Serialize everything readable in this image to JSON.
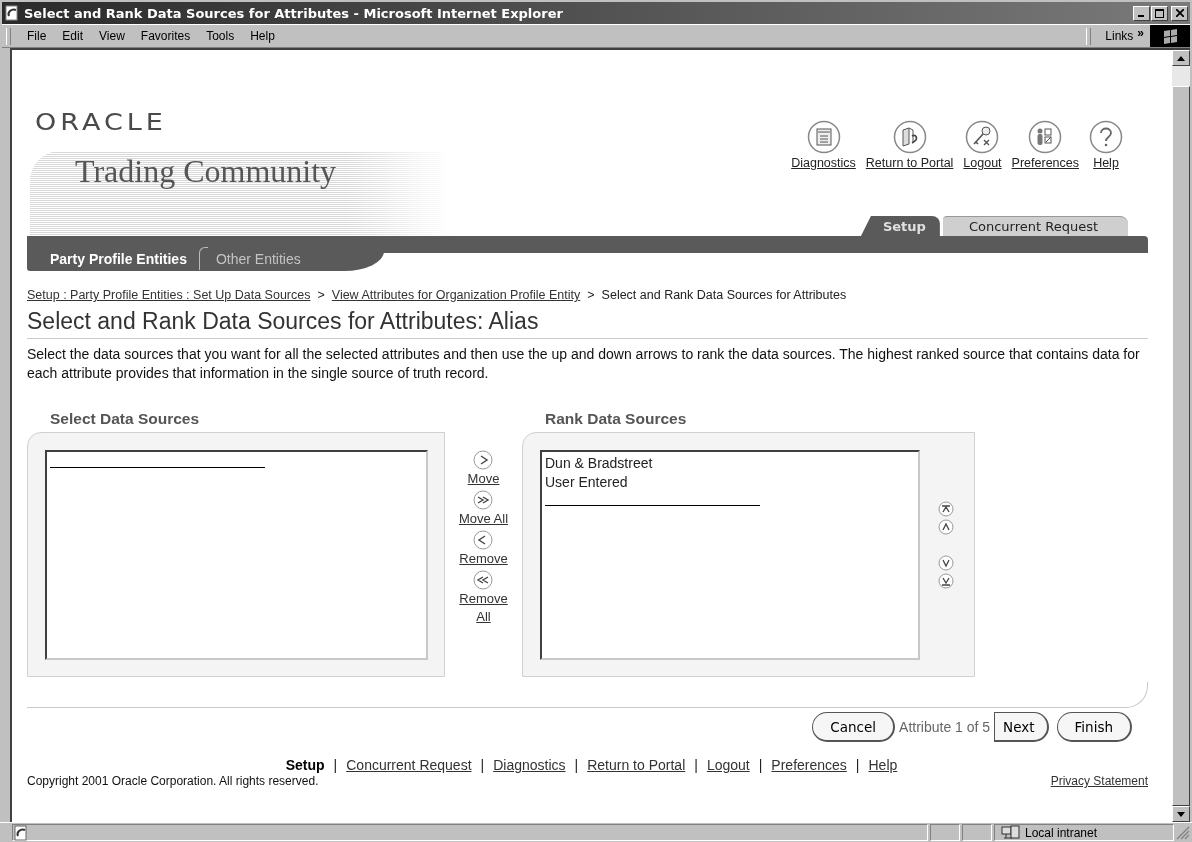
{
  "window": {
    "title": "Select and Rank Data Sources for Attributes - Microsoft Internet Explorer"
  },
  "menu": [
    "File",
    "Edit",
    "View",
    "Favorites",
    "Tools",
    "Help"
  ],
  "links_toolbar": {
    "label": "Links",
    "more": "»"
  },
  "header": {
    "logo": "ORACLE",
    "product": "Trading Community",
    "global_links": [
      {
        "label": "Diagnostics",
        "kind": "diagnostics"
      },
      {
        "label": "Return to Portal",
        "kind": "portal"
      },
      {
        "label": "Logout",
        "kind": "logout"
      },
      {
        "label": "Preferences",
        "kind": "preferences"
      },
      {
        "label": "Help",
        "kind": "help"
      }
    ],
    "tabs": [
      {
        "label": "Setup",
        "selected": true
      },
      {
        "label": "Concurrent Request",
        "selected": false
      }
    ],
    "subtabs": [
      {
        "label": "Party Profile Entities",
        "selected": true
      },
      {
        "label": "Other Entities",
        "selected": false
      }
    ]
  },
  "breadcrumbs": [
    {
      "kind": "link",
      "label": "Setup : Party Profile Entities : Set Up Data Sources"
    },
    {
      "kind": "separator",
      "label": ">"
    },
    {
      "kind": "link",
      "label": "View Attributes for Organization Profile Entity"
    },
    {
      "kind": "separator",
      "label": ">"
    },
    {
      "kind": "current",
      "label": "Select and Rank Data Sources for Attributes"
    }
  ],
  "page_title": "Select and Rank Data Sources for Attributes: Alias",
  "instructions": "Select the data sources that you want for all the selected attributes and then use the up and down arrows to rank the data sources. The highest ranked source that contains data for each attribute provides that information in the single source of truth record.",
  "shuttle": {
    "available": {
      "heading": "Select Data Sources"
    },
    "moves": [
      {
        "kind": "move",
        "label": "Move"
      },
      {
        "kind": "move_all",
        "label": "Move All"
      },
      {
        "kind": "remove",
        "label": "Remove"
      },
      {
        "kind": "remove_all",
        "label": "Remove All"
      }
    ],
    "ranked": {
      "heading": "Rank Data Sources",
      "items": [
        "Dun & Bradstreet",
        "User Entered"
      ]
    }
  },
  "train": {
    "cancel": "Cancel",
    "position": "Attribute 1 of 5",
    "next": "Next",
    "finish": "Finish"
  },
  "footer": {
    "links": [
      {
        "kind": "link",
        "label": "Setup",
        "selected": true
      },
      {
        "kind": "separator",
        "label": "|"
      },
      {
        "kind": "link",
        "label": "Concurrent Request",
        "selected": false
      },
      {
        "kind": "separator",
        "label": "|"
      },
      {
        "kind": "link",
        "label": "Diagnostics",
        "selected": false
      },
      {
        "kind": "separator",
        "label": "|"
      },
      {
        "kind": "link",
        "label": "Return to Portal",
        "selected": false
      },
      {
        "kind": "separator",
        "label": "|"
      },
      {
        "kind": "link",
        "label": "Logout",
        "selected": false
      },
      {
        "kind": "separator",
        "label": "|"
      },
      {
        "kind": "link",
        "label": "Preferences",
        "selected": false
      },
      {
        "kind": "separator",
        "label": "|"
      },
      {
        "kind": "link",
        "label": "Help",
        "selected": false
      }
    ],
    "copyright": "Copyright 2001 Oracle Corporation. All rights reserved.",
    "privacy": "Privacy Statement"
  },
  "status_bar": {
    "zone": "Local intranet"
  }
}
